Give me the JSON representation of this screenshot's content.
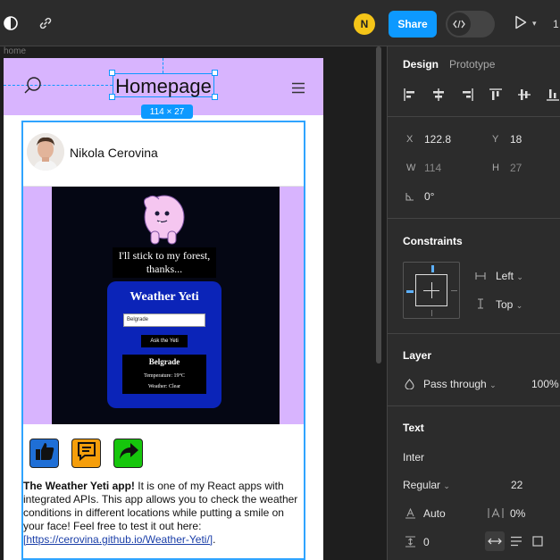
{
  "topbar": {
    "user_initial": "N",
    "share_label": "Share",
    "devmode_icon": "code-brackets-icon",
    "zoom_partial": "1"
  },
  "canvas": {
    "frame_label": "home",
    "header": {
      "title": "Homepage"
    },
    "selection_size": "114 × 27",
    "post": {
      "author_name": "Nikola Cerovina",
      "media": {
        "quote": "I'll stick to my forest, thanks...",
        "app_title": "Weather Yeti",
        "input_value": "Belgrade",
        "button_label": "Ask the Yeti",
        "result_city": "Belgrade",
        "result_temp": "Temperature: 19°C",
        "result_weather": "Weather: Clear"
      },
      "actions": [
        {
          "name": "like-button",
          "icon": "thumbs-up-icon",
          "color": "#1f6fd6"
        },
        {
          "name": "comment-button",
          "icon": "chat-bubble-icon",
          "color": "#f59e0b"
        },
        {
          "name": "share-post-button",
          "icon": "share-arrow-icon",
          "color": "#16c60c"
        }
      ],
      "text_bold": "The Weather Yeti app!",
      "text_body": " It is one of my React apps with integrated APIs. This app allows you to check the weather conditions in different locations while putting a smile on your face! Feel free to test it out here: ",
      "link_text": "[https://cerovina.github.io/Weather-Yeti/]",
      "text_end": "."
    }
  },
  "panel": {
    "tabs": [
      "Design",
      "Prototype"
    ],
    "position": {
      "x_label": "X",
      "x_value": "122.8",
      "y_label": "Y",
      "y_value": "18",
      "w_label": "W",
      "w_value": "114",
      "h_label": "H",
      "h_value": "27",
      "rotation_value": "0°"
    },
    "constraints": {
      "title": "Constraints",
      "horizontal": "Left",
      "vertical": "Top"
    },
    "layer": {
      "title": "Layer",
      "blend_mode": "Pass through",
      "opacity": "100%"
    },
    "text": {
      "title": "Text",
      "font_family": "Inter",
      "font_weight": "Regular",
      "font_size": "22",
      "line_height": "Auto",
      "letter_spacing": "0%",
      "paragraph_spacing": "0"
    }
  },
  "colors": {
    "accent": "#0d99ff",
    "header_bg": "#d8b4fe",
    "panel_bg": "#2c2c2c",
    "canvas_bg": "#1e1e1e"
  }
}
